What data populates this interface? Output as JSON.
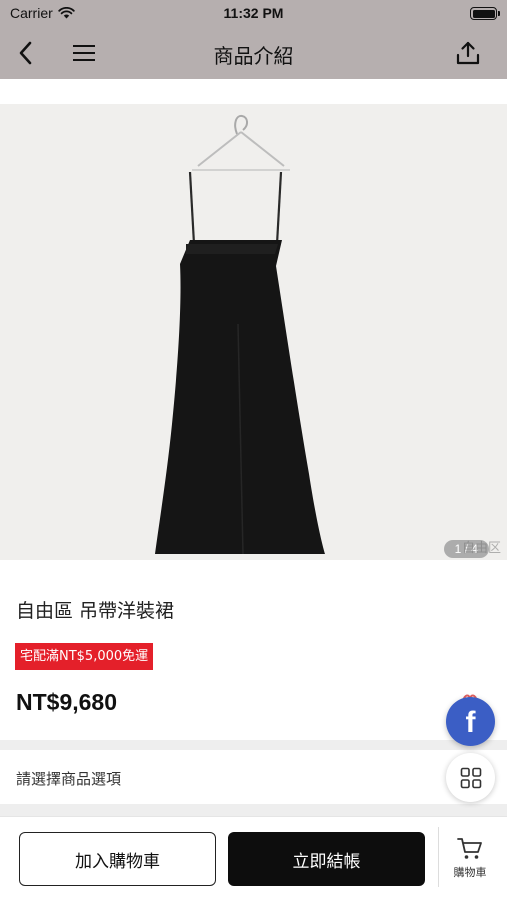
{
  "status_bar": {
    "carrier": "Carrier",
    "time": "11:32 PM",
    "battery_level": 1.0
  },
  "nav": {
    "title": "商品介紹",
    "back_icon": "chevron-left-icon",
    "menu_icon": "hamburger-menu-icon",
    "share_icon": "share-upload-icon",
    "background": "#b6afaf"
  },
  "product": {
    "image_counter": "1 / 4",
    "watermark": "自由区",
    "title": "自由區 吊帶洋裝裙",
    "shipping_badge": "宅配滿NT$5,000免運",
    "price": "NT$9,680",
    "option_prompt": "請選擇商品選項"
  },
  "floating": {
    "facebook_letter": "f",
    "facebook_color": "#3b5ec5",
    "grid_icon": "grid-apps-icon"
  },
  "bottom_bar": {
    "add_to_cart": "加入購物車",
    "checkout": "立即結帳",
    "cart_label": "購物車",
    "cart_icon": "shopping-cart-icon"
  },
  "colors": {
    "badge": "#e4202a",
    "checkout_button": "#0d0d0d"
  }
}
